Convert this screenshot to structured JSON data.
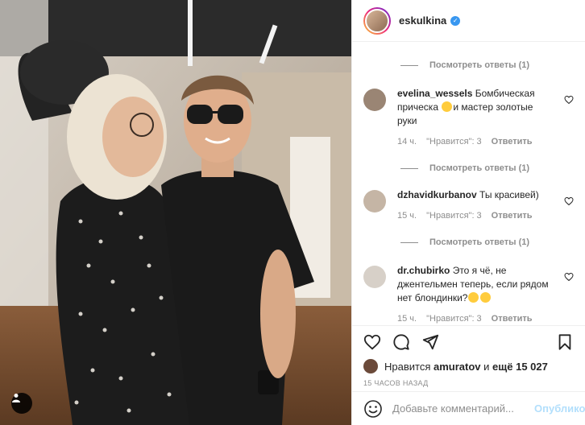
{
  "post": {
    "username": "eskulkina",
    "verified_icon": "verified-badge-icon"
  },
  "comments": [
    {
      "type": "replies",
      "label": "Посмотреть ответы (1)"
    },
    {
      "type": "comment",
      "user": "evelina_wessels",
      "text_part1": "Бомбическая прическа ",
      "text_part2": "и мастер золотые руки",
      "time": "14 ч.",
      "likes": "\"Нравится\": 3",
      "reply": "Ответить"
    },
    {
      "type": "replies",
      "label": "Посмотреть ответы (1)"
    },
    {
      "type": "comment",
      "user": "dzhavidkurbanov",
      "text_part1": "Ты красивей)",
      "time": "15 ч.",
      "likes": "\"Нравится\": 3",
      "reply": "Ответить"
    },
    {
      "type": "replies",
      "label": "Посмотреть ответы (1)"
    },
    {
      "type": "comment",
      "user": "dr.chubirko",
      "text_part1": "Это я чё, не джентельмен теперь, если рядом нет блондинки?",
      "time": "15 ч.",
      "likes": "\"Нравится\": 3",
      "reply": "Ответить"
    }
  ],
  "likes": {
    "prefix": "Нравится",
    "user": "amuratov",
    "middle": "и",
    "count": "ещё 15 027"
  },
  "timestamp": "15 ЧАСОВ НАЗАД",
  "add_comment": {
    "placeholder": "Добавьте комментарий...",
    "publish_label": "Опубликовать"
  },
  "colors": {
    "accent_blue": "#3897f0",
    "publish_disabled": "#b2dffc",
    "muted_text": "#8e8e8e"
  }
}
